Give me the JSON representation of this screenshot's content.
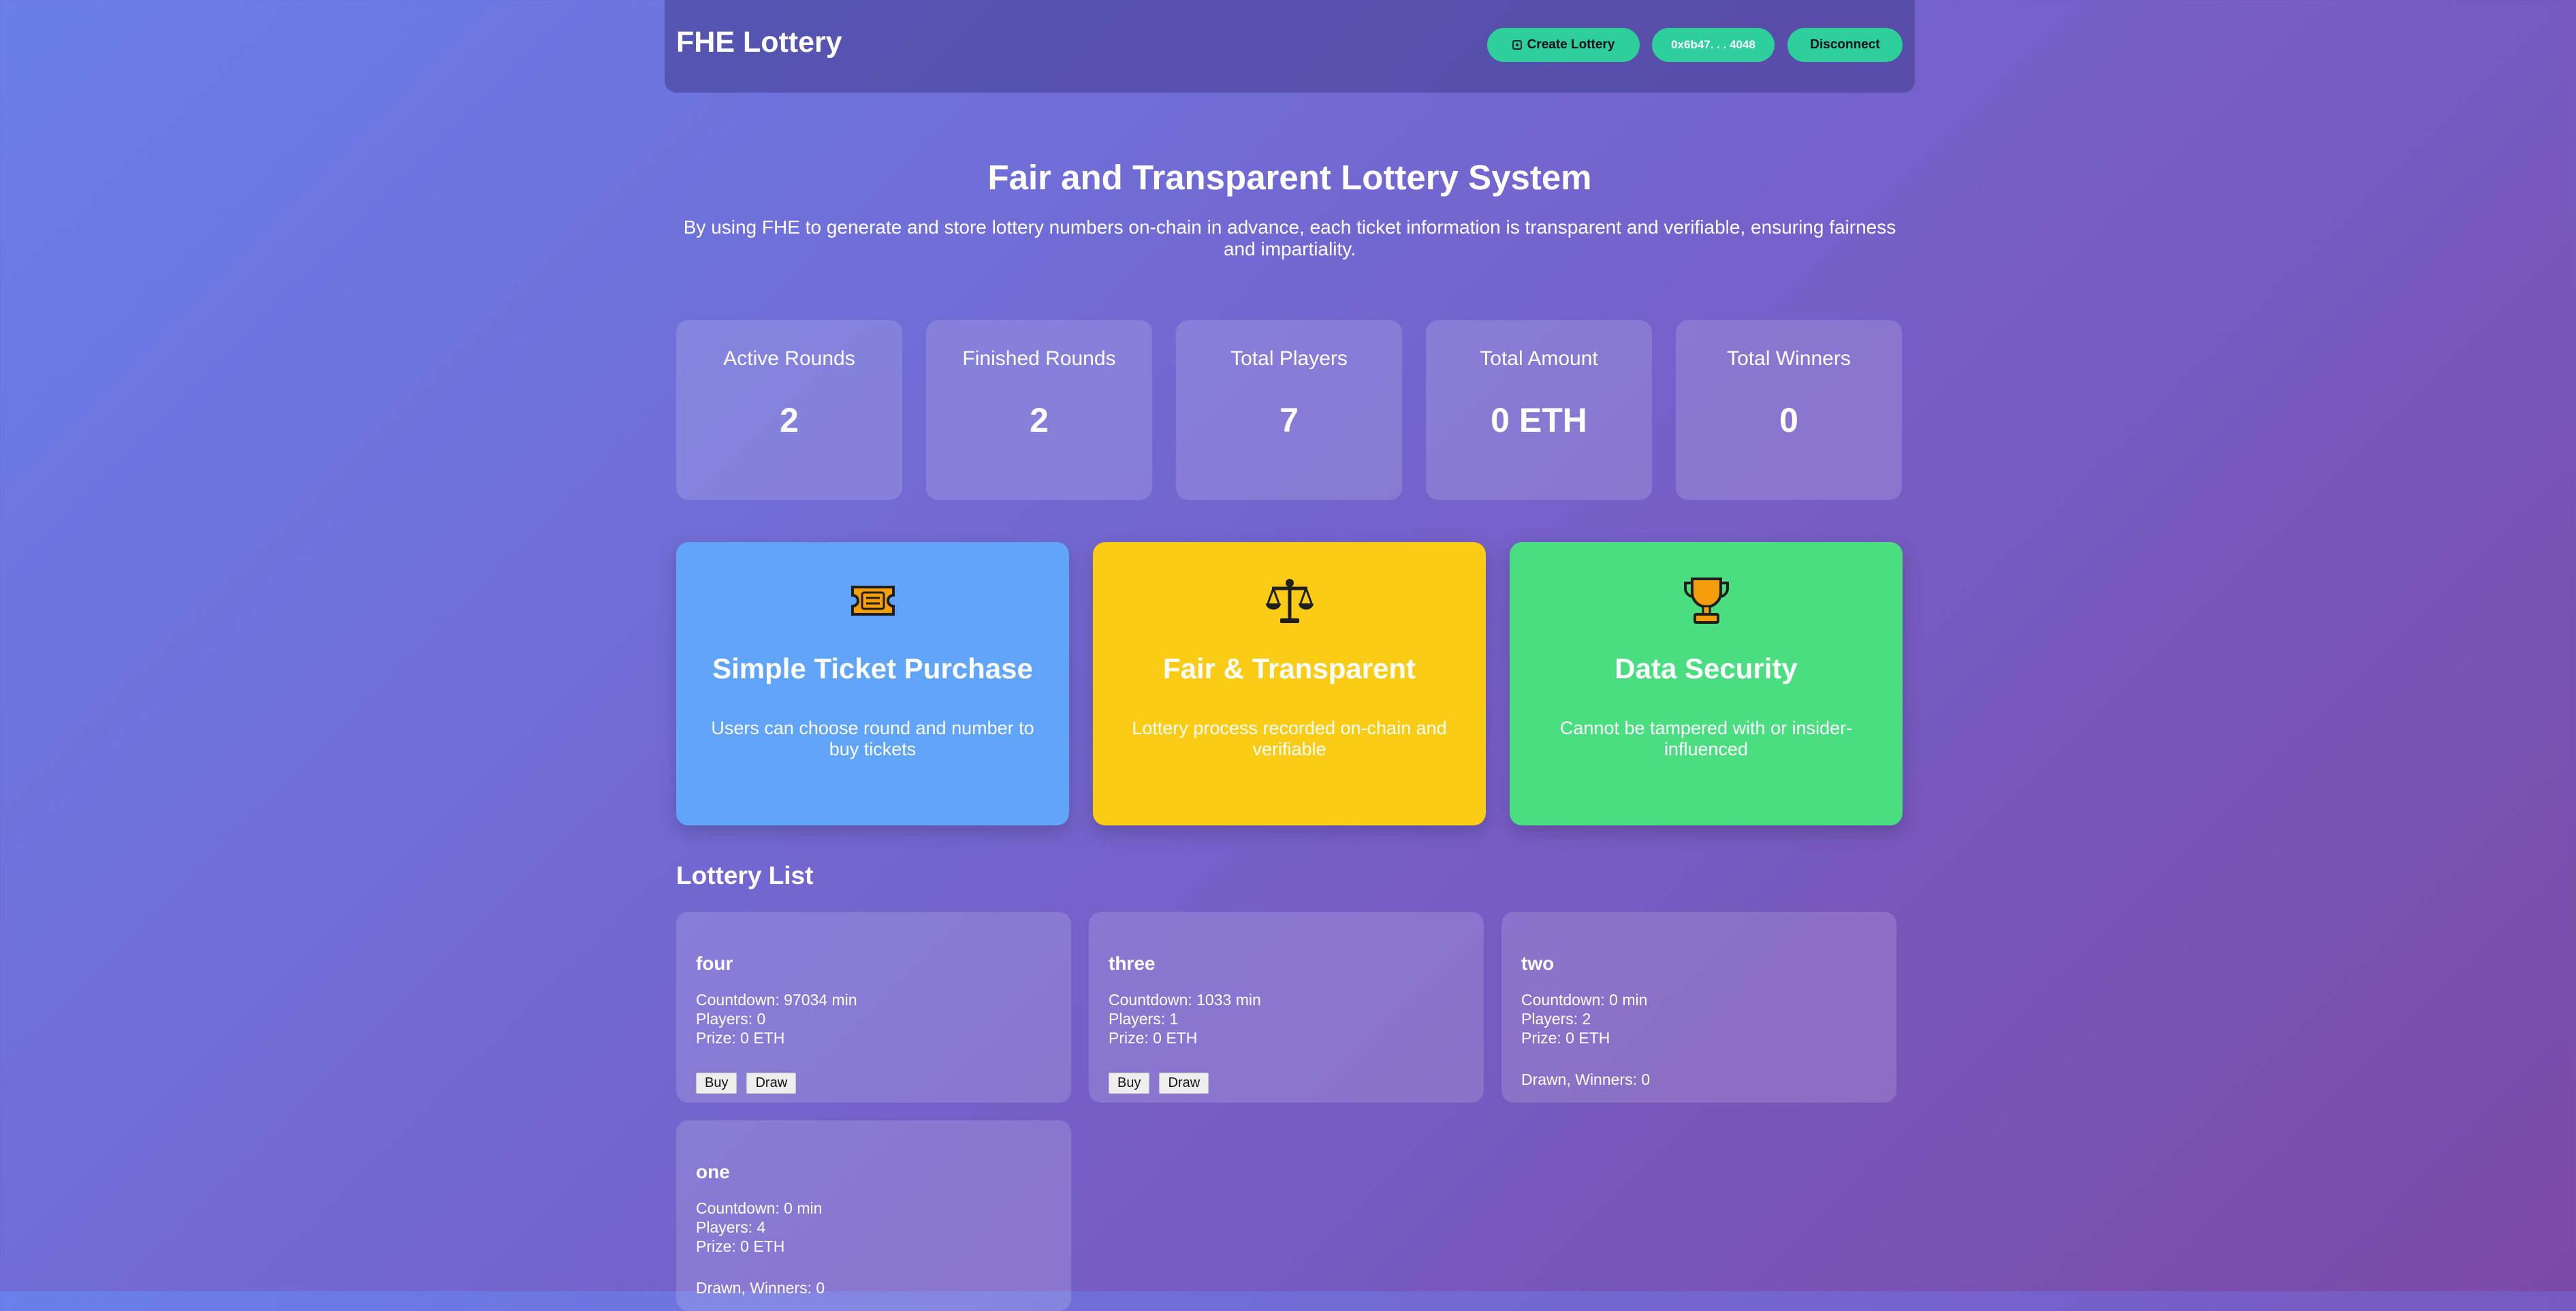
{
  "header": {
    "title": "FHE Lottery",
    "create_label": "Create Lottery",
    "create_icon": "dice-icon",
    "wallet_address": "0x6b47. . . 4048",
    "disconnect_label": "Disconnect"
  },
  "hero": {
    "title": "Fair and Transparent Lottery System",
    "subtitle": "By using FHE to generate and store lottery numbers on-chain in advance, each ticket information is transparent and verifiable, ensuring fairness and impartiality."
  },
  "stats": [
    {
      "label": "Active Rounds",
      "value": "2"
    },
    {
      "label": "Finished Rounds",
      "value": "2"
    },
    {
      "label": "Total Players",
      "value": "7"
    },
    {
      "label": "Total Amount",
      "value": "0 ETH"
    },
    {
      "label": "Total Winners",
      "value": "0"
    }
  ],
  "features": [
    {
      "icon": "ticket-icon",
      "title": "Simple Ticket Purchase",
      "desc": "Users can choose round and number to buy tickets",
      "color": "#60a5fa"
    },
    {
      "icon": "scales-icon",
      "title": "Fair & Transparent",
      "desc": "Lottery process recorded on-chain and verifiable",
      "color": "#facc15"
    },
    {
      "icon": "trophy-icon",
      "title": "Data Security",
      "desc": "Cannot be tampered with or insider-influenced",
      "color": "#4ade80"
    }
  ],
  "lottery_list": {
    "title": "Lottery List",
    "buy_label": "Buy",
    "draw_label": "Draw",
    "items": [
      {
        "name": "four",
        "countdown": "Countdown: 97034 min",
        "players": "Players: 0",
        "prize": "Prize: 0 ETH",
        "status": ""
      },
      {
        "name": "three",
        "countdown": "Countdown: 1033 min",
        "players": "Players: 1",
        "prize": "Prize: 0 ETH",
        "status": ""
      },
      {
        "name": "two",
        "countdown": "Countdown: 0 min",
        "players": "Players: 2",
        "prize": "Prize: 0 ETH",
        "status": "Drawn, Winners: 0"
      },
      {
        "name": "one",
        "countdown": "Countdown: 0 min",
        "players": "Players: 4",
        "prize": "Prize: 0 ETH",
        "status": "Drawn, Winners: 0"
      }
    ]
  }
}
